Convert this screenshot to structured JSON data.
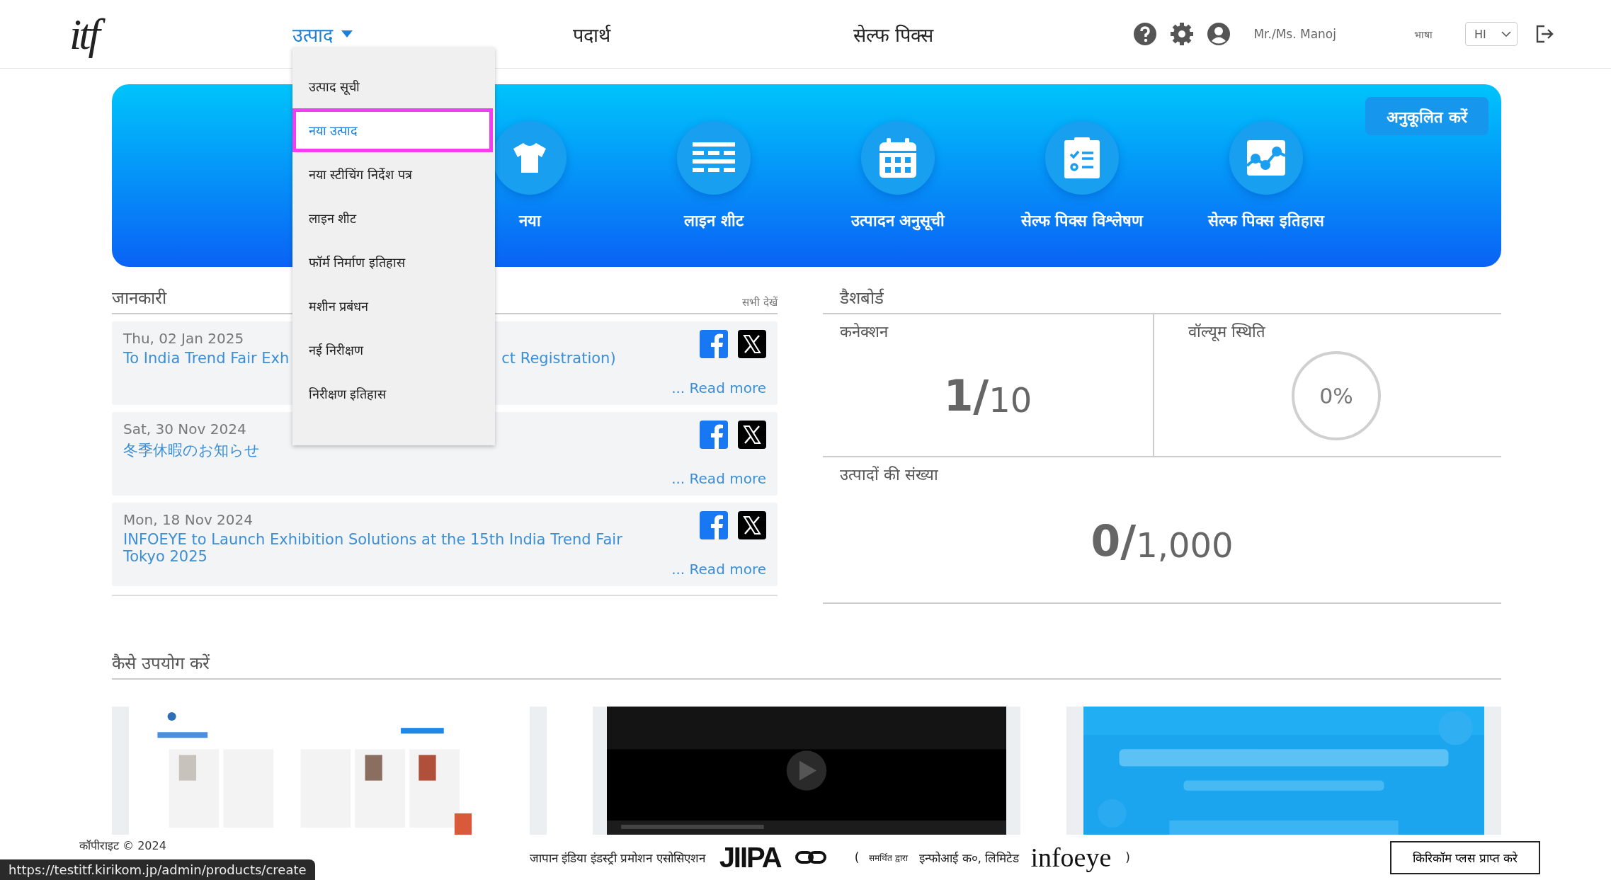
{
  "header": {
    "logo": "itf",
    "nav": [
      {
        "label": "उत्पाद",
        "selected": true
      },
      {
        "label": "पदार्थ",
        "selected": false
      },
      {
        "label": "सेल्फ पिक्स",
        "selected": false
      }
    ],
    "user": "Mr./Ms. Manoj",
    "language_label": "भाषा",
    "language": "HI"
  },
  "dropdown": [
    {
      "label": "उत्पाद सूची",
      "selected": false
    },
    {
      "label": "नया उत्पाद",
      "selected": true
    },
    {
      "label": "नया स्टीचिंग निर्देश पत्र",
      "selected": false
    },
    {
      "label": "लाइन शीट",
      "selected": false
    },
    {
      "label": "फॉर्म निर्माण इतिहास",
      "selected": false
    },
    {
      "label": "मशीन प्रबंधन",
      "selected": false
    },
    {
      "label": "नई निरीक्षण",
      "selected": false
    },
    {
      "label": "निरीक्षण इतिहास",
      "selected": false
    }
  ],
  "banner": {
    "customize_button": "अनुकूलित करें",
    "shortcuts": [
      {
        "kind": "shirt",
        "label": "नया"
      },
      {
        "kind": "lines",
        "label": "लाइन शीट"
      },
      {
        "kind": "calendar",
        "label": "उत्पादन अनुसूची"
      },
      {
        "kind": "clipboard",
        "label": "सेल्फ पिक्स विश्लेषण"
      },
      {
        "kind": "chart",
        "label": "सेल्फ पिक्स इतिहास"
      }
    ]
  },
  "info": {
    "title": "जानकारी",
    "view_all": "सभी देखें",
    "items": [
      {
        "date": "Thu, 02 Jan 2025",
        "title": "To India Trend Fair Exh",
        "title_end": "ct Registration)",
        "read_more": "... Read more"
      },
      {
        "date": "Sat, 30 Nov 2024",
        "title": "冬季休暇のお知らせ",
        "read_more": "... Read more"
      },
      {
        "date": "Mon, 18 Nov 2024",
        "title": "INFOEYE to Launch Exhibition Solutions at the 15th India Trend Fair Tokyo 2025",
        "read_more": "... Read more"
      }
    ]
  },
  "dashboard": {
    "title": "डैशबोर्ड",
    "connection": {
      "label": "कनेक्शन",
      "value": "1/",
      "max": "10"
    },
    "volume": {
      "label": "वॉल्यूम स्थिति",
      "level": 0,
      "reading": "0%"
    },
    "products": {
      "label": "उत्पादों की संख्या",
      "value": "0/",
      "max": "1,000"
    }
  },
  "how_to": {
    "title": "कैसे उपयोग करें"
  },
  "footer": {
    "copyright": "कॉपीराइट © 2024",
    "association": "जापान इंडिया इंडस्ट्री प्रमोशन एसोसिएशन",
    "association_logo": "JIIPA",
    "open_paren": "(",
    "supported_by": "समर्थित द्वारा",
    "company": "इन्फोआई क०, लिमिटेड",
    "company_logo": "infoeye",
    "close_paren": ")",
    "button": "किरिकॉम प्लस प्राप्त करे"
  },
  "status_url": "https://testitf.kirikom.jp/admin/products/create"
}
